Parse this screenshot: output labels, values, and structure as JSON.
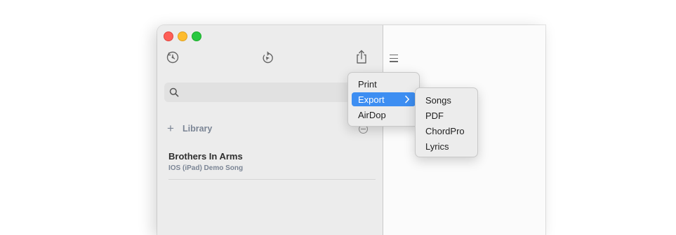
{
  "search": {
    "placeholder": ""
  },
  "sidebar": {
    "library_label": "Library",
    "songs": [
      {
        "title": "Brothers In Arms",
        "subtitle": "IOS (iPad) Demo Song"
      }
    ]
  },
  "share_menu": {
    "items": [
      {
        "label": "Print"
      },
      {
        "label": "Export",
        "selected": true,
        "has_submenu": true
      },
      {
        "label": "AirDop"
      }
    ]
  },
  "export_submenu": {
    "items": [
      {
        "label": "Songs"
      },
      {
        "label": "PDF"
      },
      {
        "label": "ChordPro"
      },
      {
        "label": "Lyrics"
      }
    ]
  },
  "colors": {
    "accent": "#3d8ef2",
    "traffic_close": "#fe5f57",
    "traffic_minimize": "#febc2e",
    "traffic_zoom": "#28c840"
  }
}
